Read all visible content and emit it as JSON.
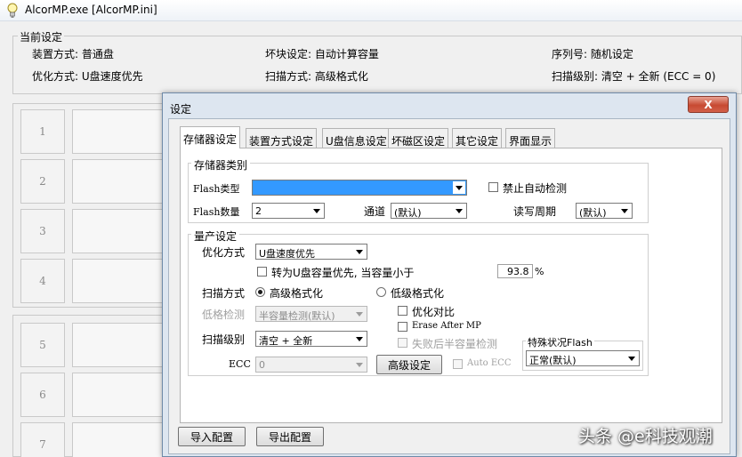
{
  "window": {
    "title": "AlcorMP.exe [AlcorMP.ini]",
    "icon": "lightbulb-icon"
  },
  "current_settings": {
    "label": "当前设定",
    "install_mode": "装置方式: 普通盘",
    "bad_block": "坏块设定: 自动计算容量",
    "serial": "序列号: 随机设定",
    "optimize": "优化方式: U盘速度优先",
    "scan_mode": "扫描方式: 高级格式化",
    "scan_level": "扫描级别: 清空 + 全新 (ECC = 0)"
  },
  "slots": [
    "1",
    "2",
    "3",
    "4",
    "5",
    "6",
    "7"
  ],
  "dialog": {
    "title": "设定",
    "close_label": "X",
    "tabs": [
      "存储器设定",
      "装置方式设定",
      "U盘信息设定",
      "坏磁区设定",
      "其它设定",
      "界面显示"
    ],
    "storage": {
      "label": "存储器类别",
      "flash_type_label": "Flash类型",
      "flash_type_value": "",
      "disable_auto_detect": "禁止自动检测",
      "flash_count_label": "Flash数量",
      "flash_count_value": "2",
      "channel_label": "通道",
      "channel_value": "(默认)",
      "rw_cycle_label": "读写周期",
      "rw_cycle_value": "(默认)"
    },
    "production": {
      "label": "量产设定",
      "optimize_label": "优化方式",
      "optimize_value": "U盘速度优先",
      "convert_label": "转为U盘容量优先, 当容量小于",
      "convert_value": "93.8",
      "convert_unit": "%",
      "scan_mode_label": "扫描方式",
      "scan_high": "高级格式化",
      "scan_low": "低级格式化",
      "low_detect_label": "低格检测",
      "low_detect_value": "半容量检测(默认)",
      "optimize_compare": "优化对比",
      "erase_after_mp": "Erase After MP",
      "fail_half_detect": "失败后半容量检测",
      "scan_level_label": "扫描级别",
      "scan_level_value": "清空 + 全新",
      "ecc_label": "ECC",
      "ecc_value": "0",
      "advanced_button": "高级设定",
      "auto_ecc": "Auto ECC",
      "special_flash_label": "特殊状况Flash",
      "special_flash_value": "正常(默认)"
    },
    "import_button": "导入配置",
    "export_button": "导出配置"
  },
  "watermark": "头条 @e科技观潮"
}
